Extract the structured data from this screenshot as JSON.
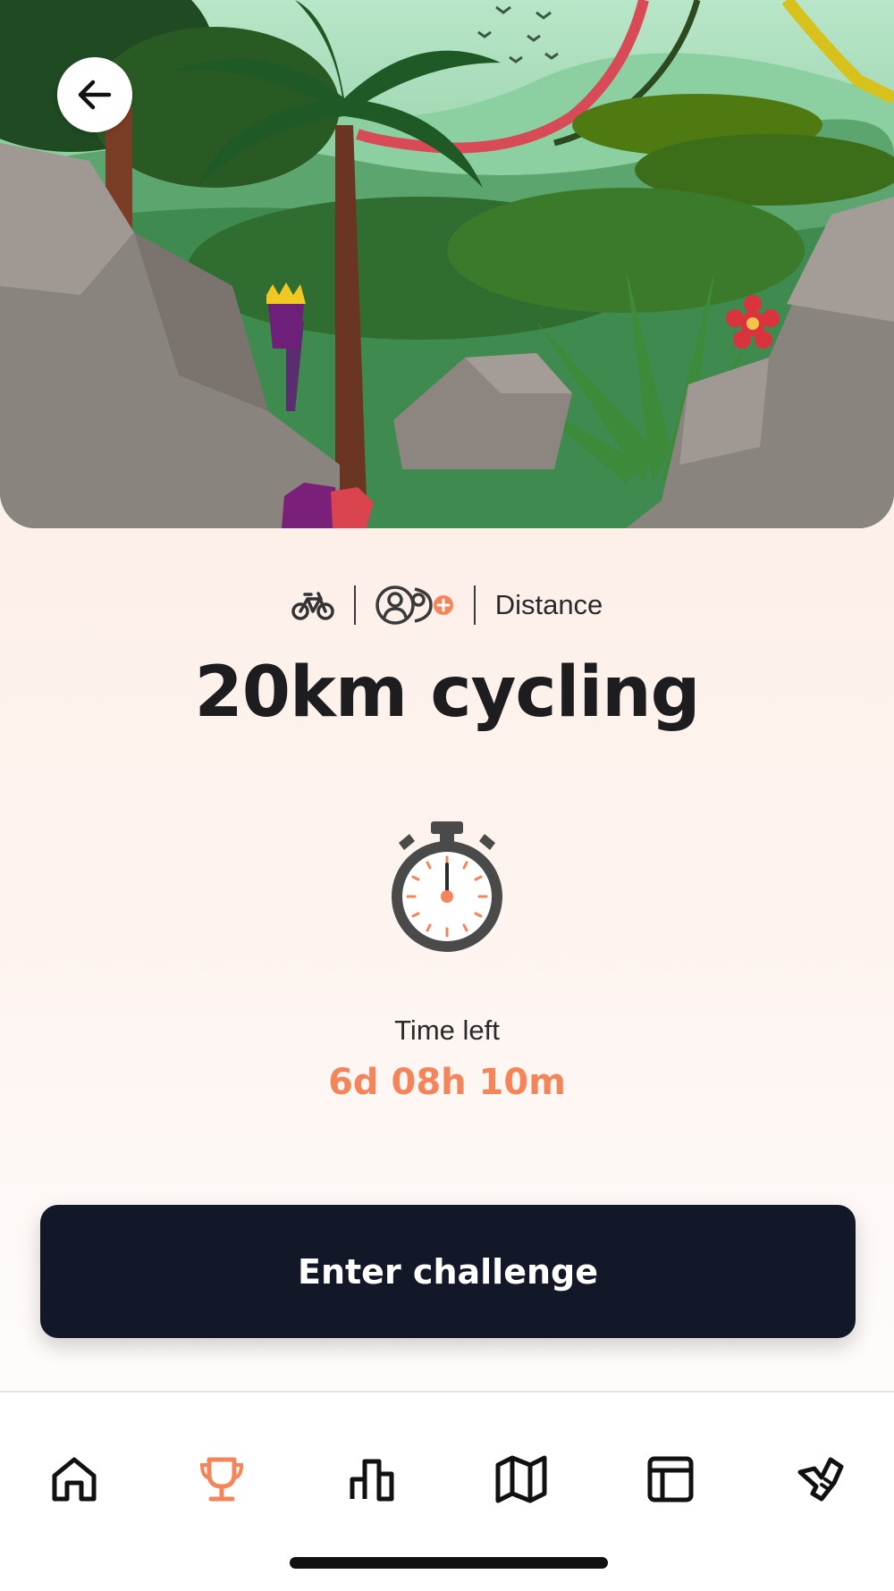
{
  "header": {
    "back_icon": "arrow-left-icon"
  },
  "challenge": {
    "sport_icon": "bicycle-icon",
    "participants_icon": "add-participants-icon",
    "category": "Distance",
    "title": "20km cycling",
    "timer_icon": "stopwatch-icon",
    "time_left_label": "Time left",
    "time_left_value": "6d 08h 10m"
  },
  "actions": {
    "enter_label": "Enter challenge"
  },
  "tabbar": {
    "items": [
      {
        "icon": "home-icon",
        "active": false
      },
      {
        "icon": "trophy-icon",
        "active": true
      },
      {
        "icon": "bar-chart-icon",
        "active": false
      },
      {
        "icon": "map-icon",
        "active": false
      },
      {
        "icon": "layout-icon",
        "active": false
      },
      {
        "icon": "shoe-icon",
        "active": false
      }
    ]
  },
  "colors": {
    "accent": "#f4845a",
    "button_bg": "#121828",
    "text_dark": "#1d1d1f"
  }
}
